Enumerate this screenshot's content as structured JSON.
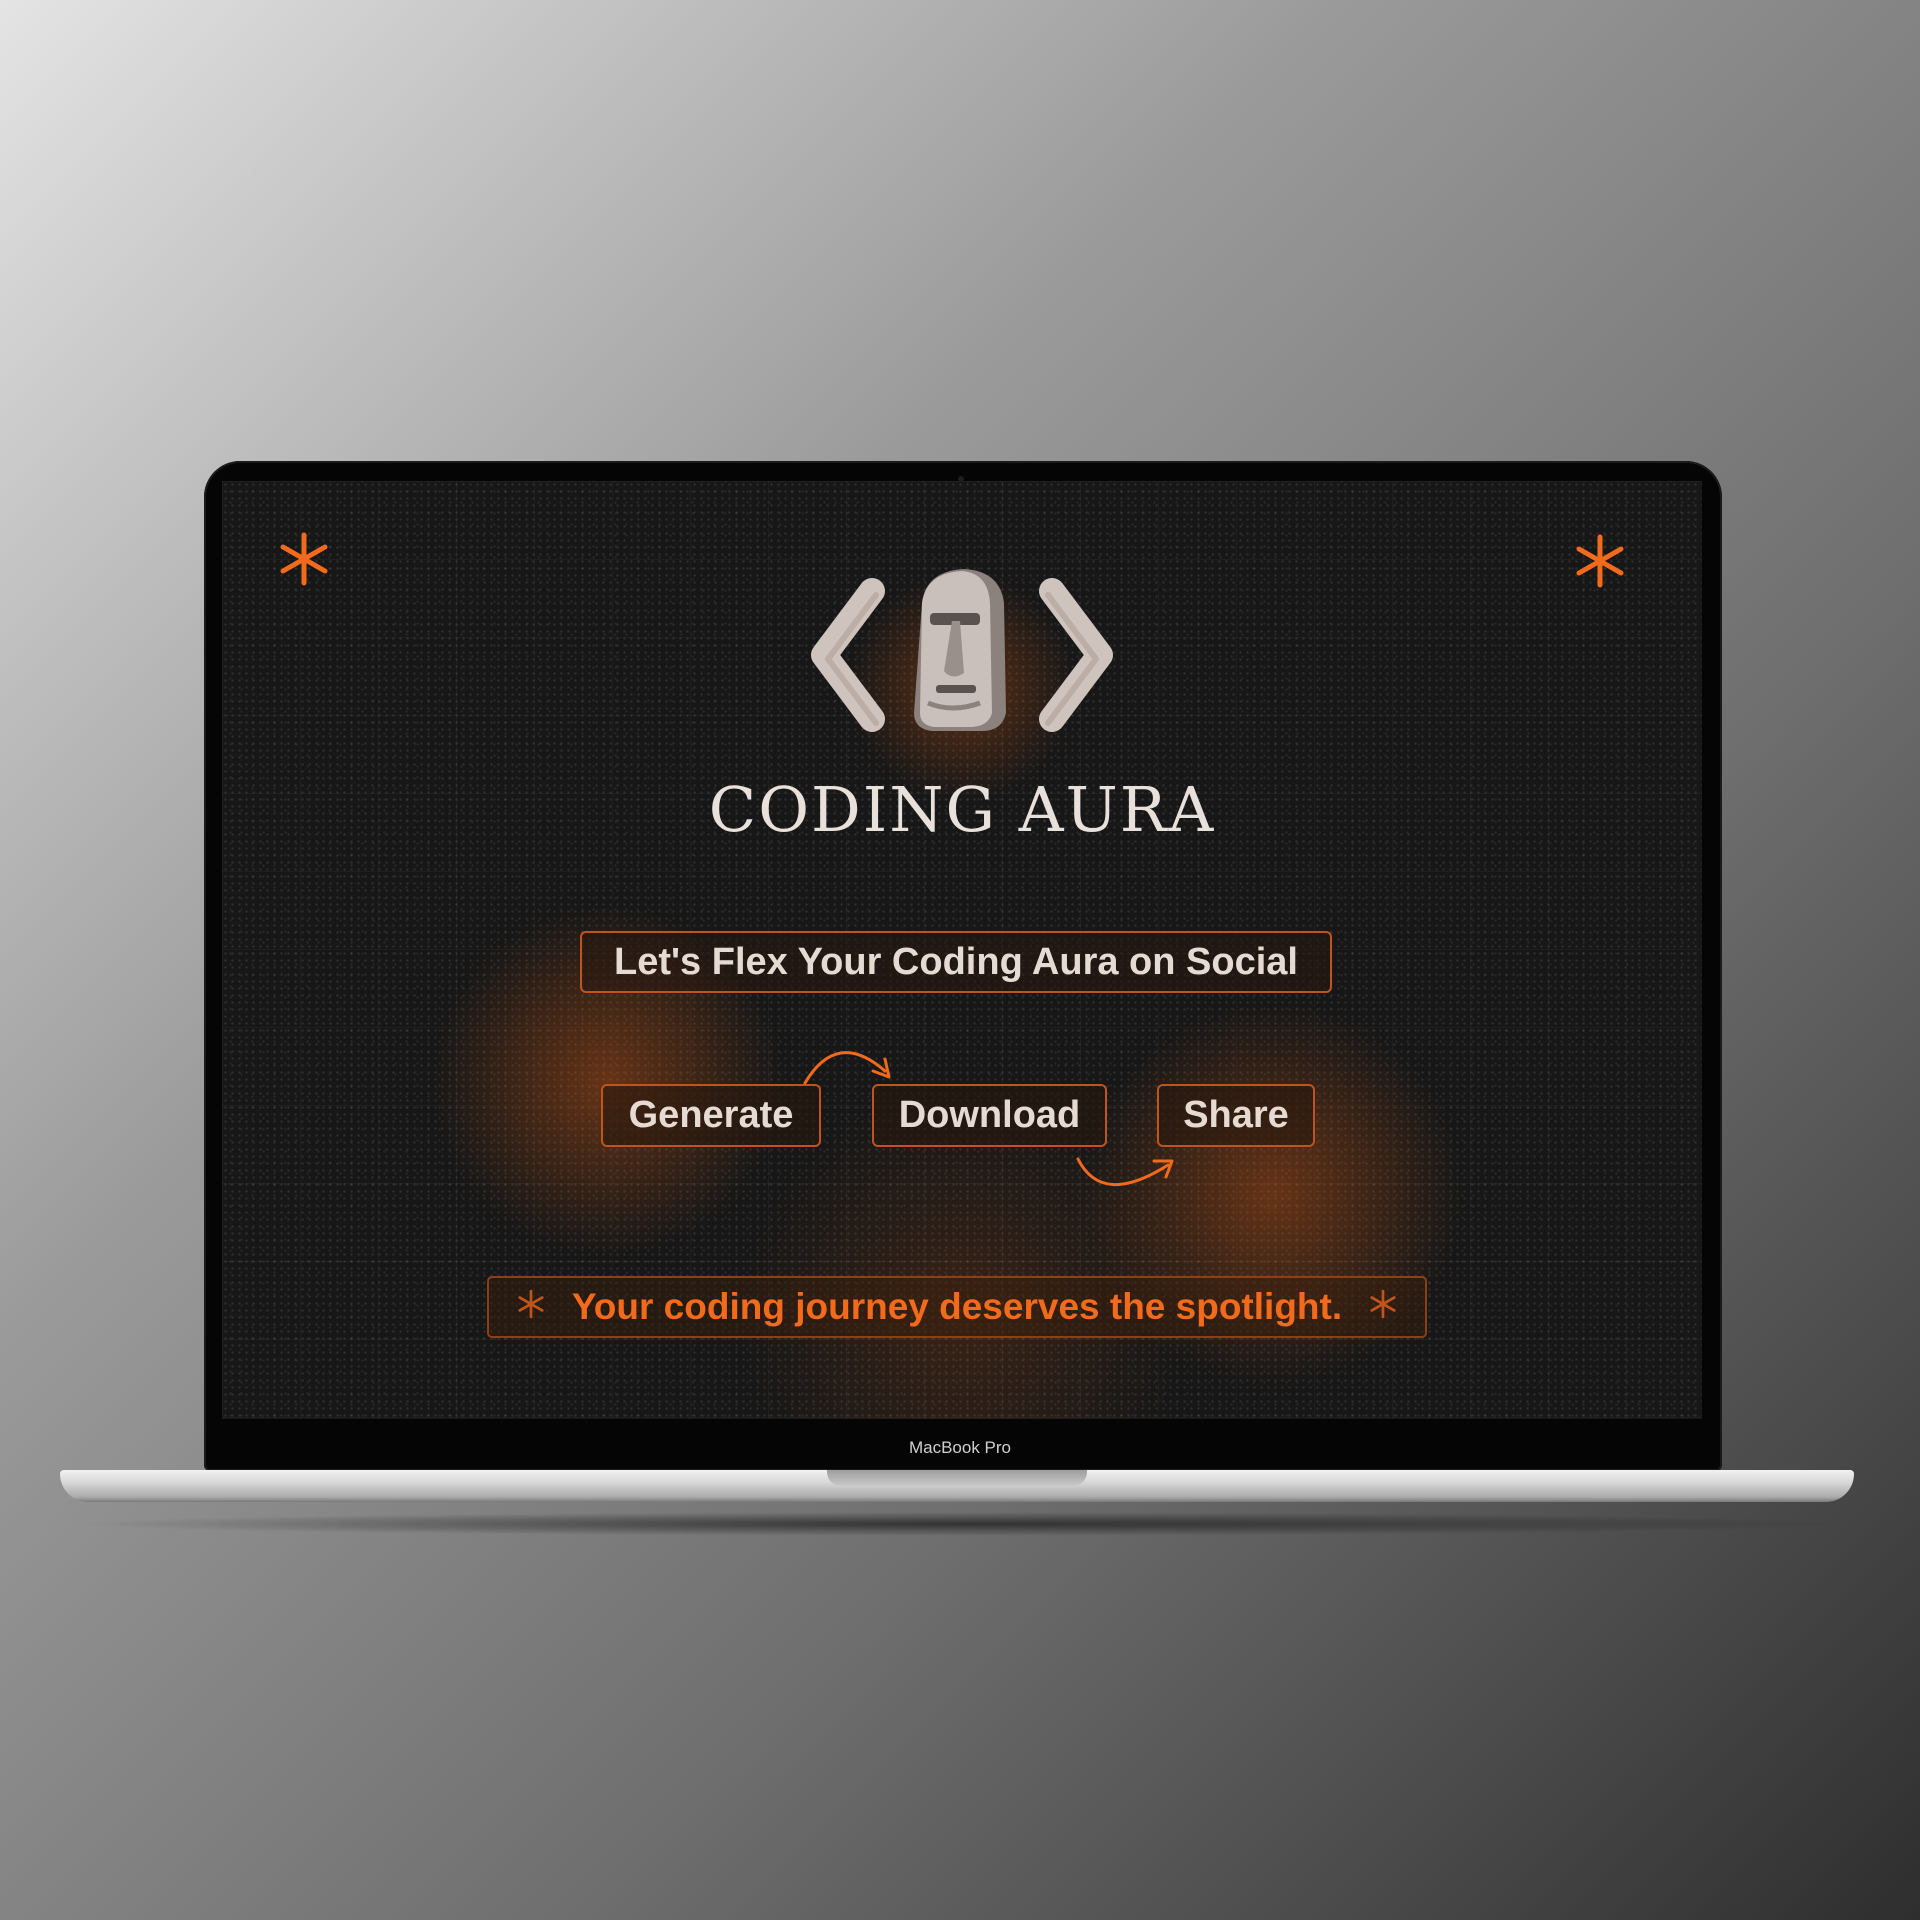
{
  "app": {
    "title": "CODING AURA",
    "logo_icon": "moai-code-brackets-icon",
    "tagline": "Let's Flex Your Coding Aura on Social",
    "steps": [
      {
        "label": "Generate"
      },
      {
        "label": "Download"
      },
      {
        "label": "Share"
      }
    ],
    "footer": {
      "text": "Your coding journey deserves the spotlight.",
      "icon": "asterisk-icon"
    },
    "decor_icon": "asterisk-icon"
  },
  "device": {
    "label": "MacBook Pro"
  },
  "colors": {
    "accent": "#f26a1b",
    "border": "#c1541c",
    "text": "#e6dbd3",
    "screen_bg": "#171717"
  }
}
